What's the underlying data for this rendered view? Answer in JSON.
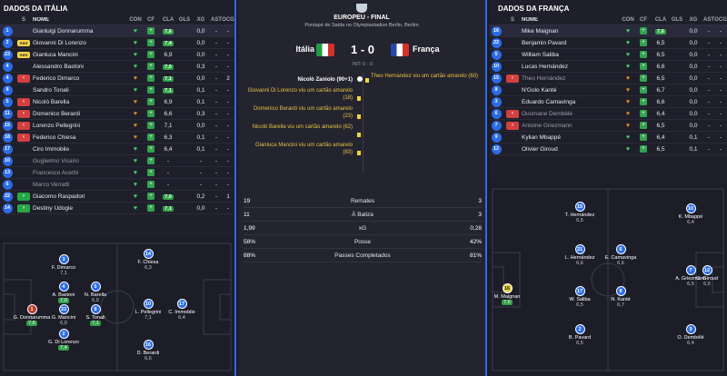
{
  "left": {
    "title": "DADOS DA ITÁLIA",
    "headers": {
      "s": "S",
      "name": "NOME",
      "con": "CON",
      "cf": "CF",
      "cla": "CLA",
      "gls": "GLS",
      "xg": "XG",
      "ast": "AST",
      "ocg": "OCG"
    },
    "rows": [
      {
        "num": "1",
        "s": "",
        "name": "Gianluigi Donnarumma",
        "con": "heart",
        "cla": "7,6",
        "rated": true,
        "gls": "",
        "xg": "0,0",
        "ast": "-",
        "ocg": "-"
      },
      {
        "num": "2",
        "s": "Amr",
        "name": "Giovanni Di Lorenzo",
        "con": "heart",
        "cla": "7,4",
        "rated": true,
        "gls": "",
        "xg": "0,0",
        "ast": "-",
        "ocg": "-"
      },
      {
        "num": "23",
        "s": "Amr",
        "name": "Gianluca Mancini",
        "con": "heart",
        "cla": "6,9",
        "rated": false,
        "gls": "",
        "xg": "0,0",
        "ast": "-",
        "ocg": "-"
      },
      {
        "num": "4",
        "s": "",
        "name": "Alessandro Bastoni",
        "con": "heart",
        "cla": "7,0",
        "rated": true,
        "gls": "",
        "xg": "0,3",
        "ast": "-",
        "ocg": "-"
      },
      {
        "num": "4",
        "s": "off",
        "name": "Federico Dimarco",
        "con": "heart-o",
        "cla": "7,1",
        "rated": true,
        "gls": "",
        "xg": "0,0",
        "ast": "-",
        "ocg": "2"
      },
      {
        "num": "8",
        "s": "",
        "name": "Sandro Tonali",
        "con": "heart",
        "cla": "7,1",
        "rated": true,
        "gls": "",
        "xg": "0,1",
        "ast": "-",
        "ocg": "-"
      },
      {
        "num": "5",
        "s": "off",
        "name": "Nicolò Barella",
        "con": "heart-o",
        "cla": "6,9",
        "rated": false,
        "gls": "",
        "xg": "0,1",
        "ast": "-",
        "ocg": "-"
      },
      {
        "num": "11",
        "s": "off",
        "name": "Domenico Berardi",
        "con": "heart-o",
        "cla": "6,6",
        "rated": false,
        "gls": "",
        "xg": "0,3",
        "ast": "-",
        "ocg": "-"
      },
      {
        "num": "15",
        "s": "off",
        "name": "Lorenzo Pellegrini",
        "con": "heart-o",
        "cla": "7,1",
        "rated": false,
        "gls": "",
        "xg": "0,0",
        "ast": "-",
        "ocg": "-"
      },
      {
        "num": "18",
        "s": "off",
        "name": "Federico Chiesa",
        "con": "heart-o",
        "cla": "6,3",
        "rated": false,
        "gls": "",
        "xg": "0,1",
        "ast": "-",
        "ocg": "-"
      },
      {
        "num": "17",
        "s": "",
        "name": "Ciro Immobile",
        "con": "heart",
        "cla": "6,4",
        "rated": false,
        "gls": "",
        "xg": "0,1",
        "ast": "-",
        "ocg": "-"
      },
      {
        "num": "10",
        "s": "",
        "name": "Guglielmo Vicario",
        "con": "heart",
        "cla": "-",
        "rated": false,
        "gls": "",
        "xg": "-",
        "ast": "-",
        "ocg": "-",
        "dim": true
      },
      {
        "num": "13",
        "s": "",
        "name": "Francesco Acerbi",
        "con": "heart",
        "cla": "-",
        "rated": false,
        "gls": "",
        "xg": "-",
        "ast": "-",
        "ocg": "-",
        "dim": true
      },
      {
        "num": "6",
        "s": "",
        "name": "Marco Verratti",
        "con": "heart",
        "cla": "-",
        "rated": false,
        "gls": "",
        "xg": "-",
        "ast": "-",
        "ocg": "-",
        "dim": true
      },
      {
        "num": "22",
        "s": "in",
        "name": "Giacomo Raspadori",
        "con": "heart",
        "cla": "7,0",
        "rated": true,
        "gls": "",
        "xg": "0,2",
        "ast": "-",
        "ocg": "1"
      },
      {
        "num": "14",
        "s": "in",
        "name": "Destiny Udogie",
        "con": "heart",
        "cla": "7,1",
        "rated": true,
        "gls": "",
        "xg": "0,0",
        "ast": "-",
        "ocg": "-"
      }
    ],
    "pitch": [
      {
        "num": "1",
        "name": "G. Donnarumma",
        "rating": "7,6",
        "good": true,
        "gk": true
      },
      {
        "num": "3",
        "name": "F. Dimarco",
        "rating": "7,1",
        "good": false
      },
      {
        "num": "4",
        "name": "A. Bastoni",
        "rating": "7,0",
        "good": true
      },
      {
        "num": "23",
        "name": "G. Mancini",
        "rating": "6,9",
        "good": false
      },
      {
        "num": "2",
        "name": "G. Di Lorenzo",
        "rating": "7,4",
        "good": true
      },
      {
        "num": "5",
        "name": "N. Barella",
        "rating": "6,9",
        "good": false
      },
      {
        "num": "8",
        "name": "S. Tonali",
        "rating": "7,1",
        "good": true
      },
      {
        "num": "14",
        "name": "F. Chiesa",
        "rating": "6,3",
        "good": false
      },
      {
        "num": "10",
        "name": "L. Pellegrini",
        "rating": "7,1",
        "good": false
      },
      {
        "num": "16",
        "name": "D. Berardi",
        "rating": "6,6",
        "good": false
      },
      {
        "num": "17",
        "name": "C. Immobile",
        "rating": "6,4",
        "good": false
      }
    ]
  },
  "center": {
    "competition": "EUROPEU - FINAL",
    "venue": "Pontapé de Saída no Olympiastadion Berlin, Berlim",
    "home": "Itália",
    "away": "França",
    "score": "1 - 0",
    "ht": "INT: 0 - 0",
    "events_left": [
      {
        "text": "Nicolò Zaniolo (90+1)",
        "goal": true
      },
      {
        "text": "Giovanni Di Lorenzo viu um cartão amarelo (18)"
      },
      {
        "text": "Domenico Berardi viu um cartão amarelo (23)"
      },
      {
        "text": "Nicolò Barella viu um cartão amarelo (62)"
      },
      {
        "text": "Gianluca Mancini viu um cartão amarelo (83)"
      }
    ],
    "events_right": [
      {
        "text": "Theo Hernández viu um cartão amarelo (60)"
      }
    ],
    "stats": [
      {
        "a": "19",
        "label": "Remates",
        "b": "3"
      },
      {
        "a": "11",
        "label": "À Baliza",
        "b": "3"
      },
      {
        "a": "1,99",
        "label": "xG",
        "b": "0,28"
      },
      {
        "a": "58%",
        "label": "Posse",
        "b": "42%"
      },
      {
        "a": "88%",
        "label": "Passes Completados",
        "b": "81%"
      }
    ]
  },
  "right": {
    "title": "DADOS DA FRANÇA",
    "headers": {
      "s": "S",
      "name": "NOME",
      "con": "CON",
      "cf": "CF",
      "cla": "CLA",
      "gls": "GLS",
      "xg": "XG",
      "ast": "AST",
      "ocg": "OCG"
    },
    "rows": [
      {
        "num": "16",
        "s": "",
        "name": "Mike Maignan",
        "con": "heart",
        "cla": "7,6",
        "rated": true,
        "gls": "",
        "xg": "0,0",
        "ast": "-",
        "ocg": "-"
      },
      {
        "num": "22",
        "s": "",
        "name": "Benjamin Pavard",
        "con": "heart",
        "cla": "6,5",
        "rated": false,
        "gls": "",
        "xg": "0,0",
        "ast": "-",
        "ocg": "-"
      },
      {
        "num": "5",
        "s": "",
        "name": "William Saliba",
        "con": "heart",
        "cla": "6,5",
        "rated": false,
        "gls": "",
        "xg": "0,0",
        "ast": "-",
        "ocg": "-"
      },
      {
        "num": "10",
        "s": "",
        "name": "Lucas Hernández",
        "con": "heart",
        "cla": "6,6",
        "rated": false,
        "gls": "",
        "xg": "0,0",
        "ast": "-",
        "ocg": "-"
      },
      {
        "num": "15",
        "s": "off",
        "name": "Theo Hernández",
        "con": "heart-o",
        "cla": "6,5",
        "rated": false,
        "gls": "",
        "xg": "0,0",
        "ast": "-",
        "ocg": "-",
        "dim": true
      },
      {
        "num": "8",
        "s": "",
        "name": "N'Golo Kanté",
        "con": "heart-o",
        "cla": "6,7",
        "rated": false,
        "gls": "",
        "xg": "0,0",
        "ast": "-",
        "ocg": "-"
      },
      {
        "num": "3",
        "s": "",
        "name": "Eduardo Camavinga",
        "con": "heart-o",
        "cla": "6,6",
        "rated": false,
        "gls": "",
        "xg": "0,0",
        "ast": "-",
        "ocg": "-"
      },
      {
        "num": "6",
        "s": "off",
        "name": "Ousmane Dembélé",
        "con": "heart-o",
        "cla": "6,4",
        "rated": false,
        "gls": "",
        "xg": "0,0",
        "ast": "-",
        "ocg": "-",
        "dim": true
      },
      {
        "num": "7",
        "s": "off",
        "name": "Antoine Griezmann",
        "con": "heart-o",
        "cla": "6,5",
        "rated": false,
        "gls": "",
        "xg": "0,0",
        "ast": "-",
        "ocg": "-",
        "dim": true
      },
      {
        "num": "9",
        "s": "",
        "name": "Kylian Mbappé",
        "con": "heart",
        "cla": "6,4",
        "rated": false,
        "gls": "",
        "xg": "0,1",
        "ast": "-",
        "ocg": "-"
      },
      {
        "num": "12",
        "s": "",
        "name": "Olivier Giroud",
        "con": "heart",
        "cla": "6,5",
        "rated": false,
        "gls": "",
        "xg": "0,1",
        "ast": "-",
        "ocg": "-"
      }
    ],
    "pitch": [
      {
        "num": "16",
        "name": "M. Maignan",
        "rating": "7,6",
        "good": true,
        "ygk": true
      },
      {
        "num": "15",
        "name": "T. Hernández",
        "rating": "6,5",
        "good": false
      },
      {
        "num": "21",
        "name": "L. Hernández",
        "rating": "6,6",
        "good": false
      },
      {
        "num": "17",
        "name": "W. Saliba",
        "rating": "6,5",
        "good": false
      },
      {
        "num": "2",
        "name": "B. Pavard",
        "rating": "6,5",
        "good": false
      },
      {
        "num": "6",
        "name": "E. Camavinga",
        "rating": "6,6",
        "good": false
      },
      {
        "num": "8",
        "name": "N. Kanté",
        "rating": "6,7",
        "good": false
      },
      {
        "num": "10",
        "name": "K. Mbappé",
        "rating": "6,4",
        "good": false
      },
      {
        "num": "7",
        "name": "A. Griezmann",
        "rating": "6,5",
        "good": false
      },
      {
        "num": "9",
        "name": "O. Dembélé",
        "rating": "6,4",
        "good": false
      },
      {
        "num": "12",
        "name": "O. Giroud",
        "rating": "6,5",
        "good": false
      }
    ]
  },
  "colors": {
    "accent": "#2c6cf0",
    "good": "#2f9e45",
    "card": "#f1d632",
    "off": "#d2403f"
  }
}
